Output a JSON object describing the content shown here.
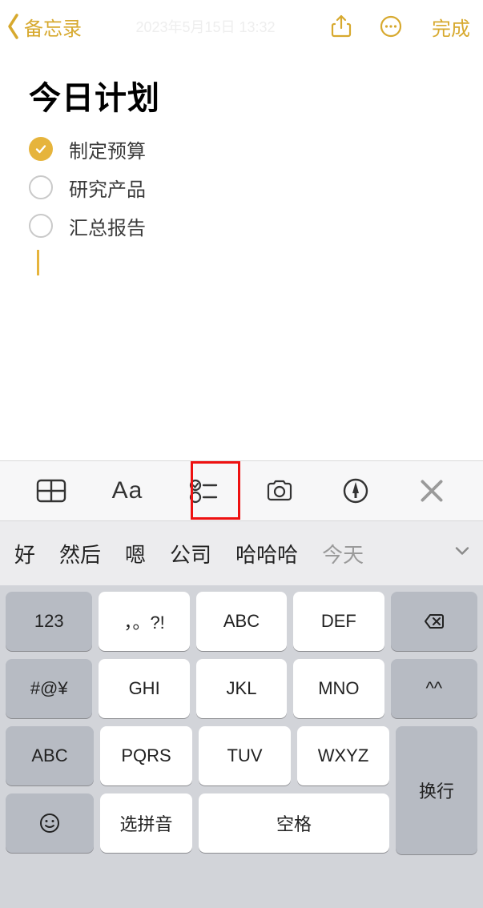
{
  "nav": {
    "back_label": "备忘录",
    "timestamp_ghost": "2023年5月15日 13:32",
    "done_label": "完成"
  },
  "note": {
    "title": "今日计划",
    "items": [
      {
        "text": "制定预算",
        "checked": true
      },
      {
        "text": "研究产品",
        "checked": false
      },
      {
        "text": "汇总报告",
        "checked": false
      }
    ]
  },
  "format_bar": {
    "aa_label": "Aa"
  },
  "keyboard": {
    "candidates": [
      "好",
      "然后",
      "嗯",
      "公司",
      "哈哈哈",
      "今天"
    ],
    "keys": {
      "num": "123",
      "punct": "，。?!",
      "abc": "ABC",
      "def": "DEF",
      "sym": "#@¥",
      "ghi": "GHI",
      "jkl": "JKL",
      "mno": "MNO",
      "face": "^^",
      "abc2": "ABC",
      "pqrs": "PQRS",
      "tuv": "TUV",
      "wxyz": "WXYZ",
      "return": "换行",
      "pinyin": "选拼音",
      "space": "空格"
    }
  }
}
